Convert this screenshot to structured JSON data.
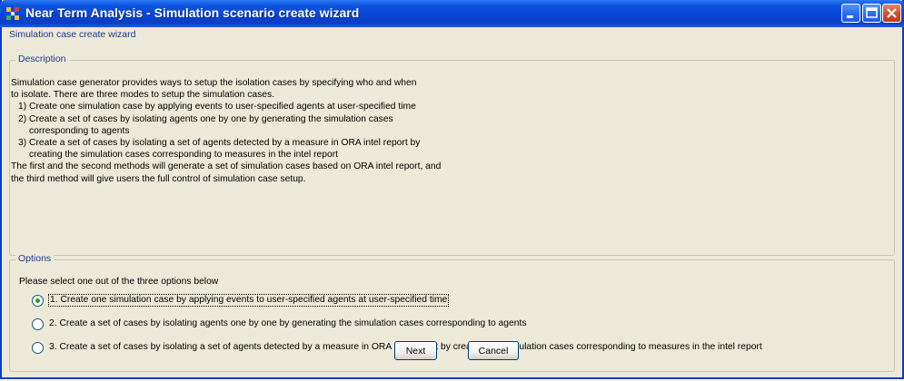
{
  "window": {
    "title": "Near Term Analysis - Simulation scenario create wizard"
  },
  "wizard_label": "Simulation case create wizard",
  "description": {
    "title": "Description",
    "lines": [
      "Simulation case generator provides ways to setup the isolation cases by specifying who and when",
      "to isolate. There are three modes to setup the simulation cases.",
      "1) Create one simulation case by applying events to user-specified agents at user-specified time",
      "2) Create a set of cases by isolating agents one by one by generating the simulation cases",
      "corresponding to agents",
      "3) Create a set of cases by isolating a set of agents detected by a measure in ORA intel report by",
      "creating the simulation cases corresponding to measures in the intel report",
      "The first and the second methods will generate a set of simulation cases based on ORA intel report, and",
      "the third method will give users the full control of simulation case setup."
    ]
  },
  "options": {
    "title": "Options",
    "prompt": "Please select one out of the three options below",
    "items": [
      {
        "label": "1. Create one simulation case by applying events to user-specified agents at user-specified time",
        "selected": true
      },
      {
        "label": "2. Create a set of cases by isolating agents one by one by generating the simulation cases corresponding to agents",
        "selected": false
      },
      {
        "label": "3. Create a set of cases by isolating a set of agents detected by a measure in ORA intel report by creating the simulation cases corresponding to measures in the intel report",
        "selected": false
      }
    ]
  },
  "buttons": {
    "next": "Next",
    "cancel": "Cancel"
  },
  "colors": {
    "title_bar": "#0843d2",
    "window_bg": "#ece9d8",
    "group_title": "#1c3a96",
    "radio_selected": "#21a121"
  }
}
